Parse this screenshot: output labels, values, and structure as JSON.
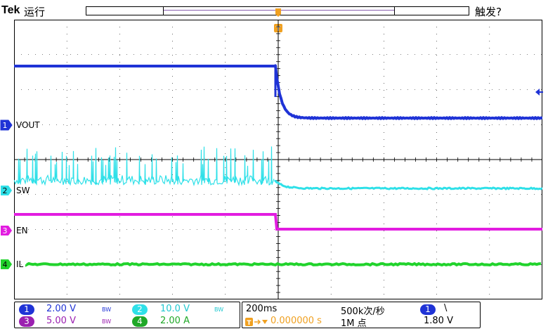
{
  "header": {
    "brand": "Tek",
    "run_status": "运行",
    "trigger_state": "触发?"
  },
  "channels": [
    {
      "id": "1",
      "label": "VOUT",
      "color": "#1f33d6"
    },
    {
      "id": "2",
      "label": "SW",
      "color": "#2fe0e8"
    },
    {
      "id": "3",
      "label": "EN",
      "color": "#e21ce0"
    },
    {
      "id": "4",
      "label": "IL",
      "color": "#21d32c"
    }
  ],
  "readout": {
    "ch1": {
      "num": "1",
      "scale": "2.00 V",
      "bw": "BW"
    },
    "ch2": {
      "num": "2",
      "scale": "10.0 V",
      "bw": "BW"
    },
    "ch3": {
      "num": "3",
      "scale": "5.00 V",
      "bw": "BW"
    },
    "ch4": {
      "num": "4",
      "scale": "2.00 A"
    },
    "timebase": "200ms",
    "trigger_pos": "0.000000 s",
    "sample_rate": "500k次/秒",
    "record_length": "1M 点",
    "trigger_source": "1",
    "trigger_slope": "\\",
    "trigger_level": "1.80 V"
  },
  "colors": {
    "trigger_marker": "#f0a020",
    "grid": "#000000",
    "ch1_readout": "#1f33d6",
    "ch2_readout": "#20c8d0",
    "ch3_readout": "#9b20b0",
    "ch4_readout": "#20a828"
  }
}
